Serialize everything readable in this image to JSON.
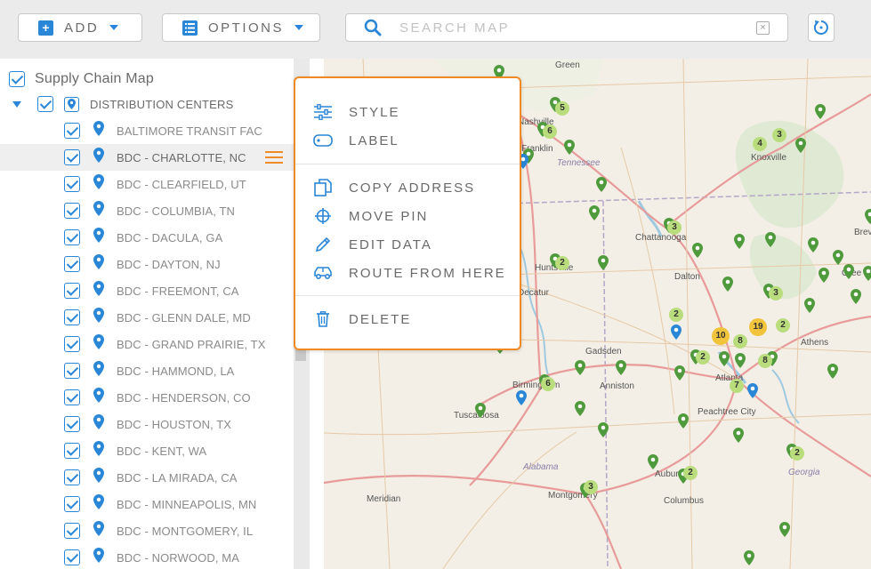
{
  "toolbar": {
    "add_label": "ADD",
    "add_icon": "plus-icon",
    "options_label": "OPTIONS",
    "options_icon": "list-icon",
    "search_placeholder": "SEARCH MAP",
    "refresh_icon": "refresh-icon"
  },
  "sidebar": {
    "title": "Supply Chain Map",
    "group_label": "DISTRIBUTION CENTERS",
    "items": [
      {
        "label": "BALTIMORE TRANSIT FAC"
      },
      {
        "label": "BDC - CHARLOTTE, NC"
      },
      {
        "label": "BDC - CLEARFIELD, UT"
      },
      {
        "label": "BDC - COLUMBIA, TN"
      },
      {
        "label": "BDC - DACULA, GA"
      },
      {
        "label": "BDC - DAYTON, NJ"
      },
      {
        "label": "BDC - FREEMONT, CA"
      },
      {
        "label": "BDC - GLENN DALE, MD"
      },
      {
        "label": "BDC - GRAND PRAIRIE, TX"
      },
      {
        "label": "BDC - HAMMOND, LA"
      },
      {
        "label": "BDC - HENDERSON, CO"
      },
      {
        "label": "BDC - HOUSTON, TX"
      },
      {
        "label": "BDC - KENT, WA"
      },
      {
        "label": "BDC - LA MIRADA, CA"
      },
      {
        "label": "BDC - MINNEAPOLIS, MN"
      },
      {
        "label": "BDC - MONTGOMERY, IL"
      },
      {
        "label": "BDC - NORWOOD, MA"
      }
    ]
  },
  "context_menu": {
    "items": [
      {
        "label": "STYLE",
        "icon": "sliders-icon"
      },
      {
        "label": "LABEL",
        "icon": "tag-icon"
      },
      {
        "label": "COPY ADDRESS",
        "icon": "copy-icon"
      },
      {
        "label": "MOVE PIN",
        "icon": "crosshair-icon"
      },
      {
        "label": "EDIT DATA",
        "icon": "pencil-icon"
      },
      {
        "label": "ROUTE FROM HERE",
        "icon": "car-icon"
      },
      {
        "label": "DELETE",
        "icon": "trash-icon"
      }
    ]
  },
  "map": {
    "places": [
      "Green",
      "Nashville",
      "Franklin",
      "Tennessee",
      "Knoxville",
      "Chattanooga",
      "Dalton",
      "Huntsville",
      "Decatur",
      "Gadsden",
      "Anniston",
      "Birmingham",
      "Tuscaloosa",
      "Atlanta",
      "Peachtree City",
      "Athens",
      "Alabama",
      "Auburn",
      "Columbus",
      "Montgomery",
      "Meridian",
      "Georgia",
      "Brev",
      "Gree"
    ],
    "clusters": [
      "5",
      "6",
      "4",
      "3",
      "3",
      "2",
      "2",
      "3",
      "10",
      "19",
      "2",
      "8",
      "8",
      "2",
      "6",
      "7",
      "3",
      "2",
      "2"
    ],
    "colors": {
      "pin_green": "#4f9a3c",
      "pin_blue": "#2a86d6",
      "cluster_green": "#b9dd7c",
      "cluster_yellow": "#f1c43c",
      "accent_orange": "#f08a24"
    }
  }
}
